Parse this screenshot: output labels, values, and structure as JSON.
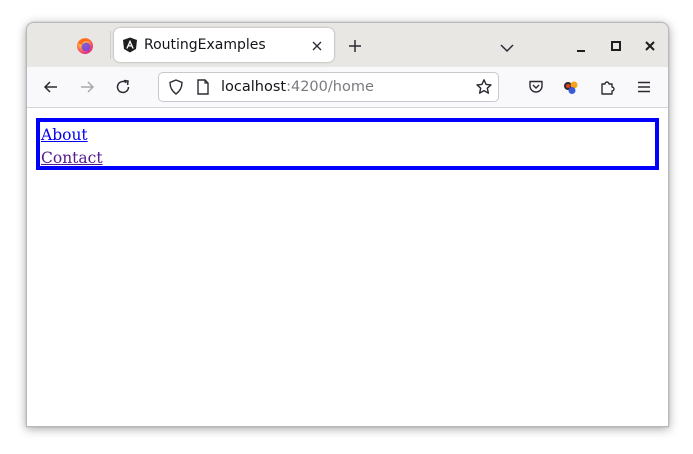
{
  "browser": {
    "tab": {
      "title": "RoutingExamples",
      "favicon": "angular-icon"
    },
    "url": {
      "host": "localhost",
      "rest": ":4200/home"
    },
    "icons": {
      "firefox": "firefox-icon",
      "close_tab": "close-icon",
      "new_tab": "plus-icon",
      "tab_list": "chevron-down-icon",
      "minimize": "minimize-icon",
      "maximize": "maximize-icon",
      "close_window": "close-icon",
      "back": "arrow-left-icon",
      "forward": "arrow-right-icon",
      "reload": "reload-icon",
      "shield": "shield-icon",
      "page": "page-icon",
      "bookmark": "star-icon",
      "pocket": "pocket-icon",
      "extension_colorful": "extension-icon",
      "extensions": "puzzle-icon",
      "menu": "hamburger-icon"
    }
  },
  "page": {
    "links": [
      {
        "label": "About",
        "visited": false
      },
      {
        "label": "Contact",
        "visited": true
      }
    ],
    "nav_border_color": "#0000ff"
  },
  "colors": {
    "tabbar_bg": "#e9e7e4",
    "navbar_bg": "#f9f9fb",
    "link_unvisited": "#0000ee",
    "link_visited": "#551a8b"
  }
}
